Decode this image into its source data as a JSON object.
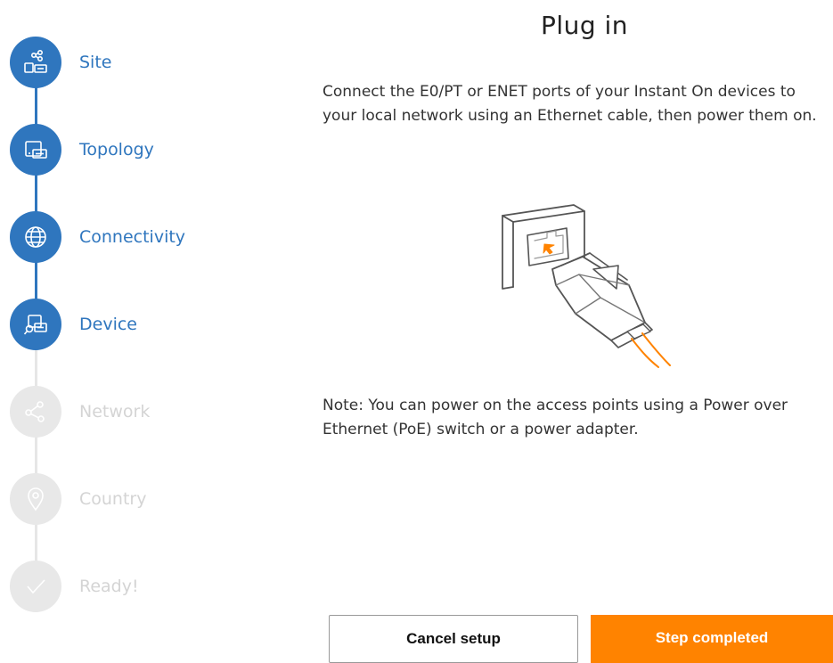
{
  "stepper": {
    "steps": [
      {
        "label": "Site",
        "state": "done",
        "icon": "site-icon"
      },
      {
        "label": "Topology",
        "state": "done",
        "icon": "topology-icon"
      },
      {
        "label": "Connectivity",
        "state": "done",
        "icon": "globe-icon"
      },
      {
        "label": "Device",
        "state": "current",
        "icon": "device-search-icon"
      },
      {
        "label": "Network",
        "state": "todo",
        "icon": "network-icon"
      },
      {
        "label": "Country",
        "state": "todo",
        "icon": "location-pin-icon"
      },
      {
        "label": "Ready!",
        "state": "todo",
        "icon": "check-icon"
      }
    ]
  },
  "main": {
    "title": "Plug in",
    "instructions": "Connect the E0/PT or ENET ports of your Instant On devices to your local network using an Ethernet cable, then power them on.",
    "note": "Note: You can power on the access points using a Power over Ethernet (PoE) switch or a power adapter.",
    "illustration": "ethernet-plug-icon"
  },
  "footer": {
    "cancel_label": "Cancel setup",
    "complete_label": "Step completed"
  },
  "colors": {
    "accent_blue": "#2f76be",
    "accent_orange": "#ff8300",
    "inactive_gray": "#e8e8e8"
  }
}
